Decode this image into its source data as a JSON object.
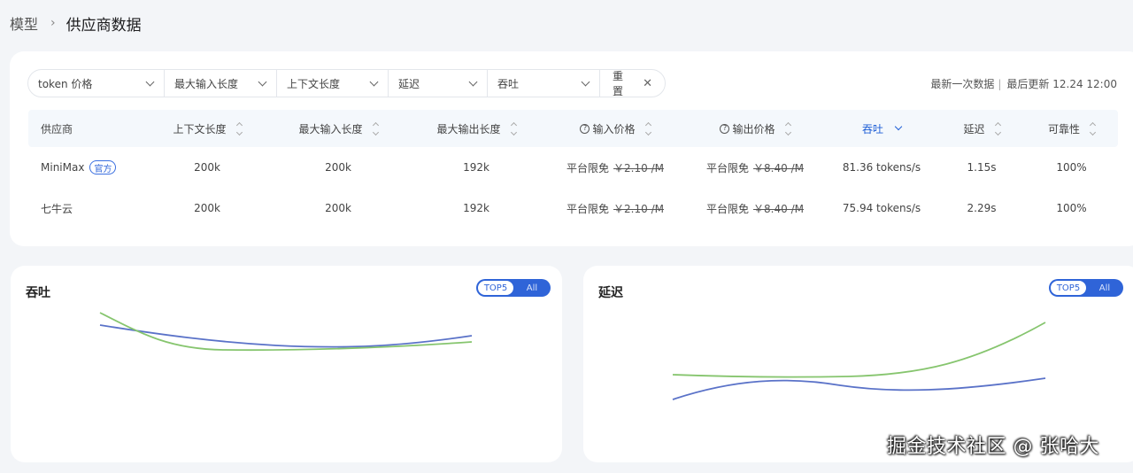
{
  "breadcrumb": {
    "parent": "模型",
    "separator": "›",
    "current": "供应商数据"
  },
  "filters": [
    {
      "label": "token 价格"
    },
    {
      "label": "最大输入长度"
    },
    {
      "label": "上下文长度"
    },
    {
      "label": "延迟"
    },
    {
      "label": "吞吐"
    }
  ],
  "reset": {
    "label": "重置",
    "icon": "close-icon"
  },
  "update_info": {
    "latest": "最新一次数据",
    "divider": "|",
    "updated": "最后更新 12.24 12:00"
  },
  "table": {
    "headers": [
      "供应商",
      "上下文长度",
      "最大输入长度",
      "最大输出长度",
      "输入价格",
      "输出价格",
      "吞吐",
      "延迟",
      "可靠性"
    ],
    "active_sort": "吞吐",
    "rows": [
      {
        "provider": "MiniMax",
        "badge": "官方",
        "context": "200k",
        "max_input": "200k",
        "max_output": "192k",
        "input_price_free": "平台限免",
        "input_price_orig": "￥2.10 /M",
        "output_price_free": "平台限免",
        "output_price_orig": "￥8.40 /M",
        "throughput": "81.36 tokens/s",
        "latency": "1.15s",
        "reliability": "100%"
      },
      {
        "provider": "七牛云",
        "badge": "",
        "context": "200k",
        "max_input": "200k",
        "max_output": "192k",
        "input_price_free": "平台限免",
        "input_price_orig": "￥2.10 /M",
        "output_price_free": "平台限免",
        "output_price_orig": "￥8.40 /M",
        "throughput": "75.94 tokens/s",
        "latency": "2.29s",
        "reliability": "100%"
      }
    ]
  },
  "charts": {
    "throughput": {
      "title": "吞吐",
      "toggle_on": "TOP5",
      "toggle_off": "All"
    },
    "latency": {
      "title": "延迟",
      "toggle_on": "TOP5",
      "toggle_off": "All"
    }
  },
  "colors": {
    "accent": "#2f64d8",
    "series_blue": "#5a72c8",
    "series_green": "#86c56e"
  },
  "watermark": "掘金技术社区 @ 张哈大"
}
